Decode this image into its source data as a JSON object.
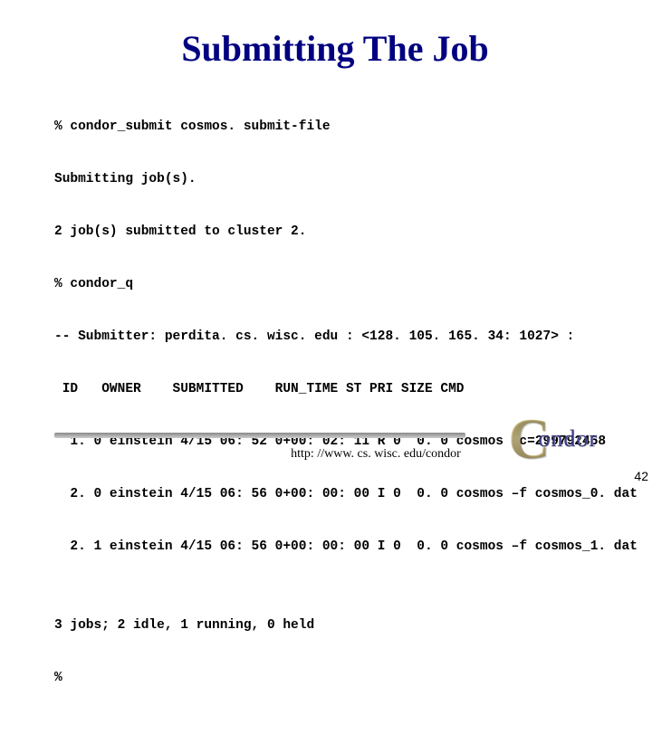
{
  "title": "Submitting The Job",
  "lines": {
    "l0": "% condor_submit cosmos. submit-file",
    "l1": "Submitting job(s).",
    "l2": "2 job(s) submitted to cluster 2.",
    "l3": "% condor_q",
    "l4": "-- Submitter: perdita. cs. wisc. edu : <128. 105. 165. 34: 1027> :",
    "hd": " ID   OWNER    SUBMITTED    RUN_TIME ST PRI SIZE CMD",
    "r1": "  1. 0 einstein 4/15 06: 52 0+00: 02: 11 R 0  0. 0 cosmos -c=299792458",
    "r2": "  2. 0 einstein 4/15 06: 56 0+00: 00: 00 I 0  0. 0 cosmos –f cosmos_0. dat",
    "r3": "  2. 1 einstein 4/15 06: 56 0+00: 00: 00 I 0  0. 0 cosmos –f cosmos_1. dat",
    "sum": "3 jobs; 2 idle, 1 running, 0 held",
    "prompt": "%"
  },
  "footer": {
    "url": "http: //www. cs. wisc. edu/condor",
    "logo_rest": "ondor",
    "page": "42"
  }
}
